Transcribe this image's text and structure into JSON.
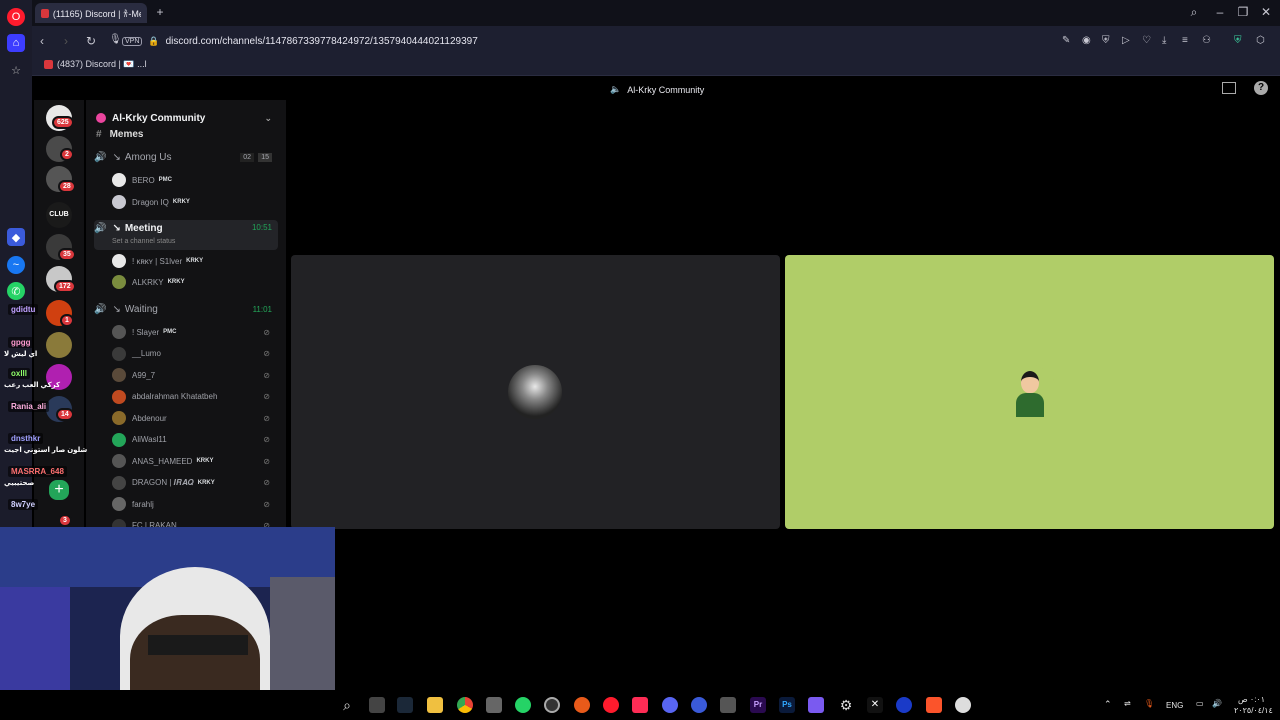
{
  "browser": {
    "tabs": [
      {
        "title": "(11165) Discord | 𐀪-Meeti",
        "active": true
      }
    ],
    "new_tab_icon": "plus-icon",
    "url": "discord.com/channels/1147867339778424972/1357940444021129397",
    "vpn_label": "VPN",
    "bookmark": "(4837) Discord | 💌 ...l"
  },
  "discord": {
    "voice_title": "Al-Krky Community",
    "server_name": "Al-Krky Community",
    "rail_badges": [
      "625",
      "2",
      "28",
      "35",
      "172",
      "1",
      "14",
      "3"
    ],
    "rail_label": "CLUB",
    "channels": {
      "memes": "Memes",
      "among_us": {
        "name": "Among Us",
        "count_a": "02",
        "count_b": "15"
      },
      "meeting": {
        "name": "Meeting",
        "status": "Set a channel status",
        "time": "10:51"
      },
      "waiting": {
        "name": "Waiting",
        "time": "11:01"
      }
    },
    "among_us_members": [
      {
        "name": "BERO",
        "tag": "PMC",
        "color": "#e8e8e8"
      },
      {
        "name": "Dragon IQ",
        "tag": "KRKY",
        "color": "#c8c8d0"
      }
    ],
    "meeting_members": [
      {
        "name": "! ᴋʀᴋʏ | S1lver",
        "tag": "KRKY",
        "color": "#e8e8e8"
      },
      {
        "name": "ALKRKY",
        "tag": "KRKY",
        "color": "#7a8c3e"
      }
    ],
    "waiting_members": [
      {
        "name": "! Slayer",
        "tag": "PMC",
        "color": "#555"
      },
      {
        "name": "__Lumo",
        "tag": "",
        "color": "#3a3a3a"
      },
      {
        "name": "A99_7",
        "tag": "",
        "color": "#5a4a3a"
      },
      {
        "name": "abdalrahman Khatatbeh",
        "tag": "",
        "color": "#c04a20"
      },
      {
        "name": "Abdenour",
        "tag": "",
        "color": "#8a6a2a"
      },
      {
        "name": "AliWasl11",
        "tag": "",
        "color": "#23a559"
      },
      {
        "name": "ANAS_HAMEED",
        "tag": "KRKY",
        "color": "#555"
      },
      {
        "name": "DRAGON | 𝑰𝑹𝑨𝑸",
        "tag": "KRKY",
        "color": "#444"
      },
      {
        "name": "farahlj",
        "tag": "",
        "color": "#666"
      },
      {
        "name": "FC | RAKAN",
        "tag": "",
        "color": "#333"
      }
    ]
  },
  "stream_chat": [
    {
      "name": "gdidtu",
      "msg": "",
      "color": "#c0a0ff"
    },
    {
      "name": "gpgg",
      "msg": "اي ليش لا",
      "color": "#ff9ad0"
    },
    {
      "name": "oxlll",
      "msg": "كركي العب رعب",
      "color": "#8fff6a"
    },
    {
      "name": "Rania_ali",
      "msg": "",
      "color": "#ffb0e0"
    },
    {
      "name": "dnsthkr",
      "msg": "شلون صار استوني اجيت",
      "color": "#a0a0ff"
    },
    {
      "name": "MASRRA_648",
      "msg": "صحتيبيي",
      "color": "#ff7070"
    },
    {
      "name": "8w7ye",
      "msg": "",
      "color": "#d0d0ff"
    }
  ],
  "taskbar": {
    "lang": "ENG",
    "time": "٠:٠١ ص",
    "date": "٢٠٢٥/٠٤/١٤"
  },
  "icons": [
    "opera-logo-icon",
    "home-icon",
    "star-icon",
    "search-icon",
    "minimize-icon",
    "maximize-icon",
    "close-icon",
    "back-icon",
    "forward-icon",
    "reload-icon",
    "lock-icon",
    "chevron-down-icon",
    "mute-icon",
    "settings-icon",
    "help-icon",
    "windows-search-icon"
  ],
  "colors": {
    "discord_bg": "#121214",
    "tile_right": "#b0cd68",
    "tile_left": "#222225",
    "browser_dark": "#1d1f30",
    "accent_green": "#23a559"
  }
}
